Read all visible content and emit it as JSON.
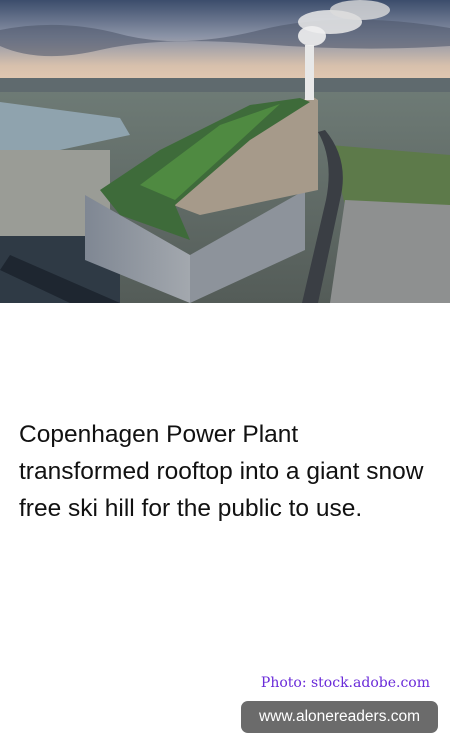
{
  "caption": "Copenhagen Power Plant transformed rooftop into a giant snow free ski hill for the public to use.",
  "credit": "Photo: stock.adobe.com",
  "site": "www.alonereaders.com"
}
